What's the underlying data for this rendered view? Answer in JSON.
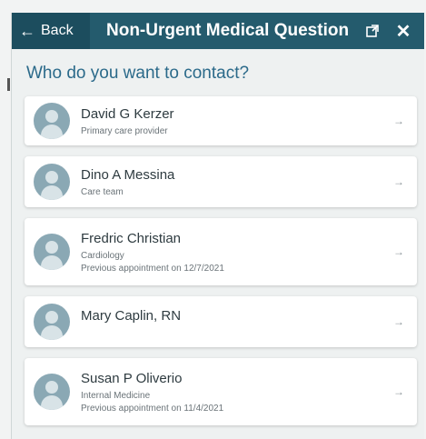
{
  "header": {
    "back_label": "Back",
    "title": "Non-Urgent Medical Question",
    "popout_icon": "popout-icon",
    "close_icon": "close-icon",
    "color": "#245b6d"
  },
  "prompt": "Who do you want to contact?",
  "contacts": [
    {
      "name": "David G Kerzer",
      "line1": "Primary care provider",
      "line2": ""
    },
    {
      "name": "Dino A Messina",
      "line1": "Care team",
      "line2": ""
    },
    {
      "name": "Fredric Christian",
      "line1": "Cardiology",
      "line2": "Previous appointment on 12/7/2021"
    },
    {
      "name": "Mary Caplin, RN",
      "line1": "",
      "line2": ""
    },
    {
      "name": "Susan P Oliverio",
      "line1": "Internal Medicine",
      "line2": "Previous appointment on 11/4/2021"
    }
  ],
  "chevron": "→"
}
